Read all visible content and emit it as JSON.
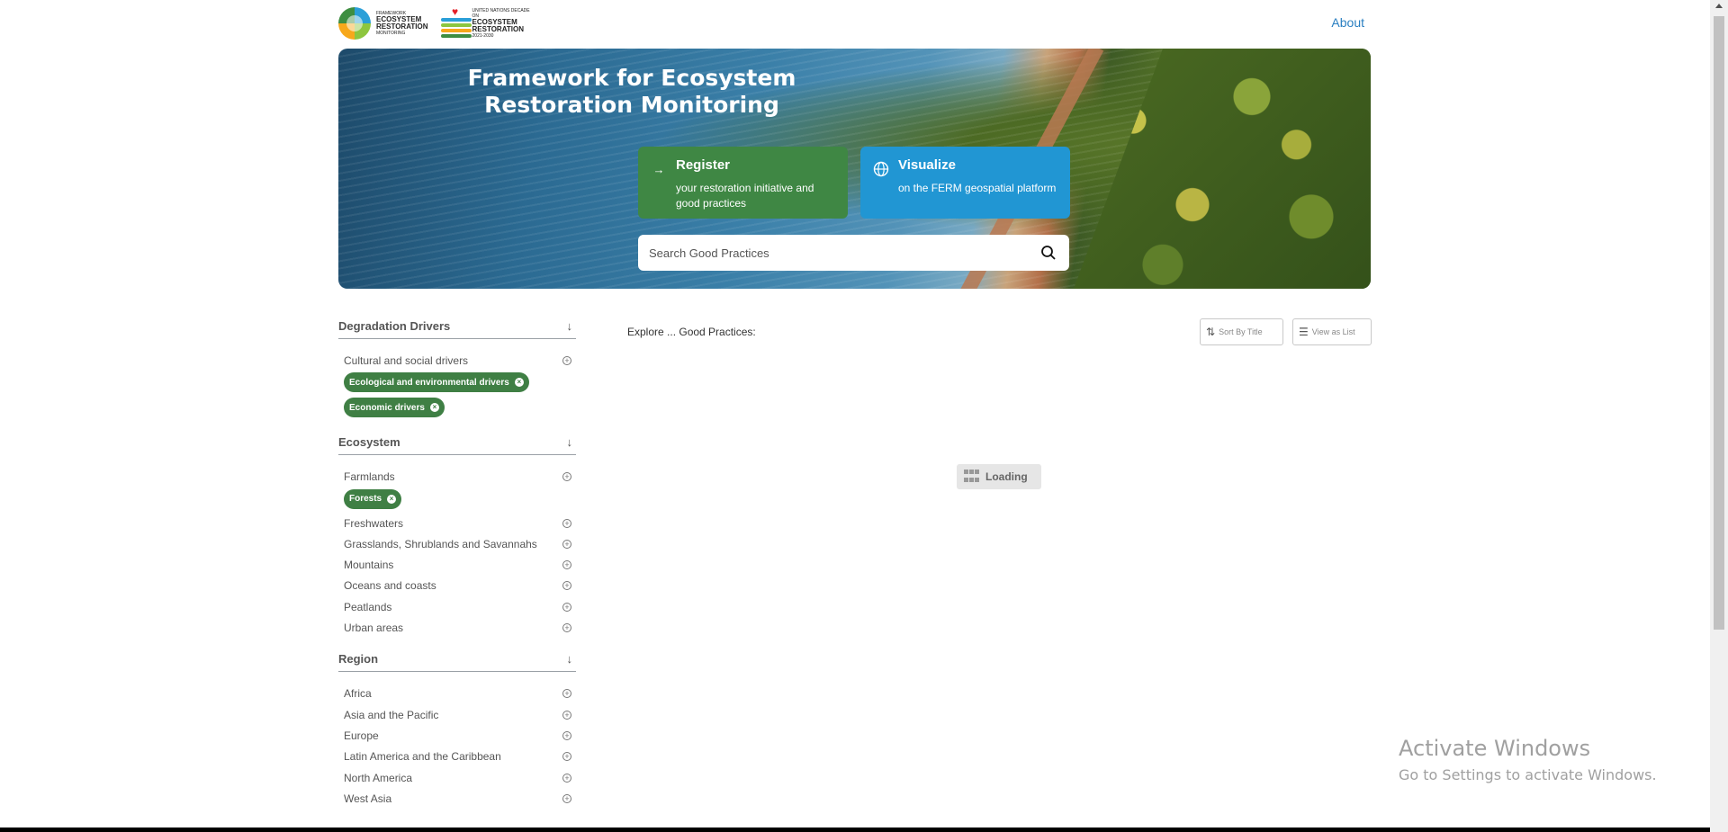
{
  "header": {
    "logo1": {
      "line_small": "FRAMEWORK",
      "line1": "ECOSYSTEM",
      "line2": "RESTORATION",
      "line_small2": "MONITORING"
    },
    "logo2": {
      "line_small": "UNITED NATIONS DECADE ON",
      "line1": "ECOSYSTEM",
      "line2": "RESTORATION",
      "line_small2": "2021-2030"
    },
    "about_label": "About"
  },
  "hero": {
    "title": "Framework for Ecosystem Restoration Monitoring",
    "register": {
      "title": "Register",
      "subtitle": "your restoration initiative and good practices",
      "icon": "arrow-right-icon",
      "color": "#3f8744"
    },
    "visualize": {
      "title": "Visualize",
      "subtitle": "on the FERM geospatial platform",
      "icon": "globe-icon",
      "color": "#2196d3"
    },
    "search": {
      "placeholder": "Search Good Practices",
      "value": ""
    }
  },
  "sidebar": {
    "facets": [
      {
        "title": "Degradation Drivers",
        "options": [
          "Cultural and social drivers"
        ],
        "selected": [
          "Ecological and environmental drivers",
          "Economic drivers"
        ]
      },
      {
        "title": "Ecosystem",
        "options_before": [
          "Farmlands"
        ],
        "selected": [
          "Forests"
        ],
        "options_after": [
          "Freshwaters",
          "Grasslands, Shrublands and Savannahs",
          "Mountains",
          "Oceans and coasts",
          "Peatlands",
          "Urban areas"
        ]
      },
      {
        "title": "Region",
        "options": [
          "Africa",
          "Asia and the Pacific",
          "Europe",
          "Latin America and the Caribbean",
          "North America",
          "West Asia"
        ]
      }
    ]
  },
  "main": {
    "explore_label": "Explore ... Good Practices:",
    "sort_label": "Sort By Title",
    "view_label": "View as List",
    "loading_label": "Loading"
  },
  "watermark": {
    "title": "Activate Windows",
    "subtitle": "Go to Settings to activate Windows."
  },
  "colors": {
    "accent_green": "#3f7f44",
    "link_blue": "#2a7fc1",
    "visualize_blue": "#2196d3"
  }
}
